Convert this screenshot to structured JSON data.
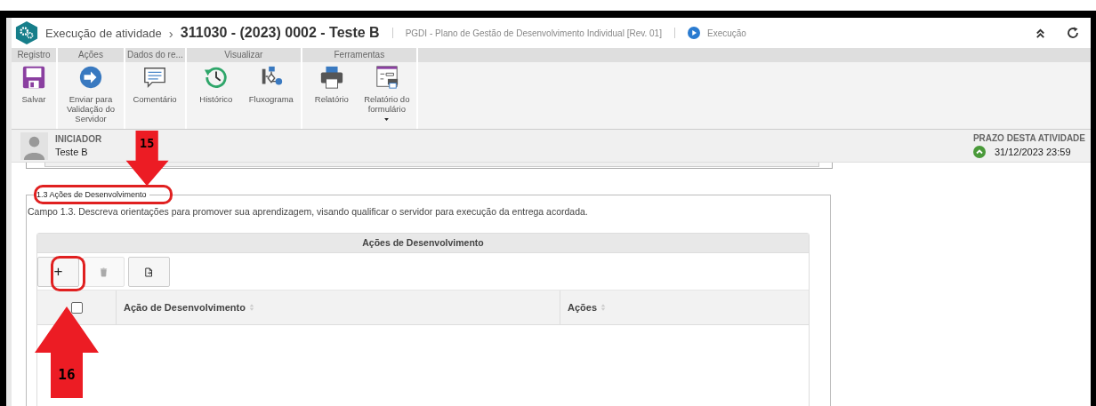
{
  "header": {
    "parent": "Execução de atividade",
    "separator": "›",
    "title": "311030 - (2023) 0002 - Teste B",
    "process": "PGDI - Plano de Gestão de Desenvolvimento Individual [Rev. 01]",
    "status": "Execução"
  },
  "ribbon": [
    {
      "group": "Registro",
      "buttons": [
        {
          "label": "Salvar",
          "kind": "save",
          "dropdown": false
        }
      ]
    },
    {
      "group": "Ações",
      "buttons": [
        {
          "label": "Enviar para Validação do Servidor",
          "kind": "send",
          "dropdown": false
        }
      ]
    },
    {
      "group": "Dados do re...",
      "buttons": [
        {
          "label": "Comentário",
          "kind": "comment",
          "dropdown": false
        }
      ]
    },
    {
      "group": "Visualizar",
      "buttons": [
        {
          "label": "Histórico",
          "kind": "history",
          "dropdown": false
        },
        {
          "label": "Fluxograma",
          "kind": "flow",
          "dropdown": false
        }
      ]
    },
    {
      "group": "Ferramentas",
      "buttons": [
        {
          "label": "Relatório",
          "kind": "print",
          "dropdown": false
        },
        {
          "label": "Relatório do formulário",
          "kind": "form",
          "dropdown": true
        }
      ]
    }
  ],
  "initiator": {
    "label": "INICIADOR",
    "name": "Teste B"
  },
  "deadline": {
    "label": "PRAZO DESTA ATIVIDADE",
    "date": "31/12/2023 23:59"
  },
  "section": {
    "legend": "1.3 Ações de Desenvolvimento",
    "description": "Campo 1.3. Descreva orientações para promover sua aprendizagem, visando qualificar o servidor para execução da entrega acordada.",
    "grid": {
      "title": "Ações de Desenvolvimento",
      "toolbar": [
        {
          "kind": "add",
          "label": "+",
          "disabled": false
        },
        {
          "kind": "delete",
          "disabled": true
        },
        {
          "kind": "export",
          "disabled": false
        }
      ],
      "select_all_checked": false,
      "columns": [
        "Ação de Desenvolvimento",
        "Ações"
      ]
    }
  },
  "annotations": [
    {
      "number": "15",
      "kind": "down"
    },
    {
      "number": "16",
      "kind": "up"
    }
  ]
}
